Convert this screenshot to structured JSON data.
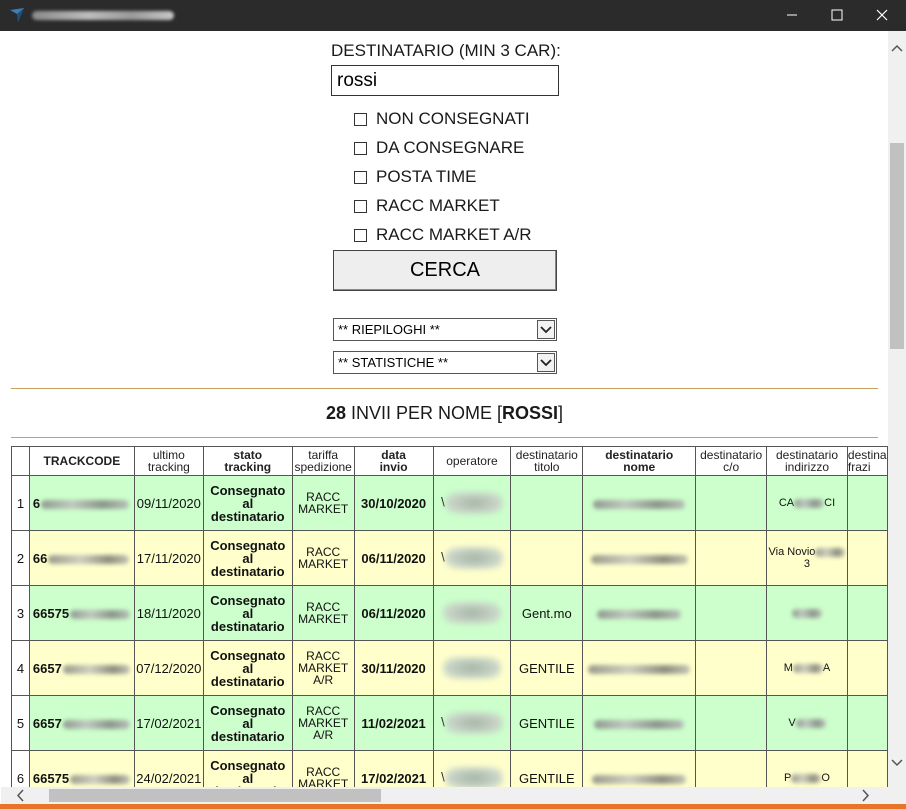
{
  "window": {
    "controls": {
      "minimize": "minimize-icon",
      "maximize": "maximize-icon",
      "close": "close-icon"
    }
  },
  "form": {
    "label": "DESTINATARIO (MIN 3 CAR):",
    "search_value": "rossi",
    "checkboxes": [
      {
        "label": "NON CONSEGNATI",
        "checked": false
      },
      {
        "label": "DA CONSEGNARE",
        "checked": false
      },
      {
        "label": "POSTA TIME",
        "checked": false
      },
      {
        "label": "RACC MARKET",
        "checked": false
      },
      {
        "label": "RACC MARKET A/R",
        "checked": false
      }
    ],
    "submit_label": "CERCA",
    "select_riepiloghi": "** RIEPILOGHI **",
    "select_statistiche": "** STATISTICHE **"
  },
  "results": {
    "count": "28",
    "text": "INVII PER NOME",
    "name": "ROSSI"
  },
  "table": {
    "headers": [
      {
        "line1": "",
        "line2": ""
      },
      {
        "line1": "TRACKCODE",
        "line2": ""
      },
      {
        "line1": "ultimo",
        "line2": "tracking"
      },
      {
        "line1": "stato",
        "line2": "tracking"
      },
      {
        "line1": "tariffa",
        "line2": "spedizione"
      },
      {
        "line1": "data",
        "line2": "invio"
      },
      {
        "line1": "operatore",
        "line2": ""
      },
      {
        "line1": "destinatario",
        "line2": "titolo"
      },
      {
        "line1": "destinatario",
        "line2": "nome"
      },
      {
        "line1": "destinatario",
        "line2": "c/o"
      },
      {
        "line1": "destinatario",
        "line2": "indirizzo"
      },
      {
        "line1": "destina",
        "line2": "frazi"
      }
    ],
    "rows": [
      {
        "idx": "1",
        "track": "6",
        "ultimo": "09/11/2020",
        "stato": [
          "Consegnato",
          "al",
          "destinatario"
        ],
        "tariffa": [
          "RACC",
          "MARKET"
        ],
        "data": "30/10/2020",
        "operatore": "\\",
        "titolo": "",
        "nome": "",
        "co": "",
        "indirizzo": [
          "CA",
          "CI"
        ],
        "frazione": ""
      },
      {
        "idx": "2",
        "track": "66",
        "ultimo": "17/11/2020",
        "stato": [
          "Consegnato",
          "al",
          "destinatario"
        ],
        "tariffa": [
          "RACC",
          "MARKET"
        ],
        "data": "06/11/2020",
        "operatore": "\\",
        "titolo": "",
        "nome": "",
        "co": "",
        "indirizzo": [
          "Via Novio",
          "3"
        ],
        "frazione": ""
      },
      {
        "idx": "3",
        "track": "66575",
        "ultimo": "18/11/2020",
        "stato": [
          "Consegnato",
          "al",
          "destinatario"
        ],
        "tariffa": [
          "RACC",
          "MARKET"
        ],
        "data": "06/11/2020",
        "operatore": "",
        "titolo": "Gent.mo",
        "nome": "",
        "co": "",
        "indirizzo": [
          "",
          ""
        ],
        "frazione": ""
      },
      {
        "idx": "4",
        "track": "6657",
        "ultimo": "07/12/2020",
        "stato": [
          "Consegnato",
          "al",
          "destinatario"
        ],
        "tariffa": [
          "RACC",
          "MARKET",
          "A/R"
        ],
        "data": "30/11/2020",
        "operatore": "",
        "titolo": "GENTILE",
        "nome": "",
        "co": "",
        "indirizzo": [
          "M",
          "A"
        ],
        "frazione": ""
      },
      {
        "idx": "5",
        "track": "6657",
        "ultimo": "17/02/2021",
        "stato": [
          "Consegnato",
          "al",
          "destinatario"
        ],
        "tariffa": [
          "RACC",
          "MARKET",
          "A/R"
        ],
        "data": "11/02/2021",
        "operatore": "\\",
        "titolo": "GENTILE",
        "nome": "",
        "co": "",
        "indirizzo": [
          "V",
          ""
        ],
        "frazione": ""
      },
      {
        "idx": "6",
        "track": "66575",
        "ultimo": "24/02/2021",
        "stato": [
          "Consegnato",
          "al",
          "destinatario"
        ],
        "tariffa": [
          "RACC",
          "MARKET"
        ],
        "data": "17/02/2021",
        "operatore": "\\",
        "titolo": "GENTILE",
        "nome": "",
        "co": "",
        "indirizzo": [
          "P",
          "O"
        ],
        "frazione": ""
      }
    ]
  },
  "scrollbars": {
    "vertical_position": 0.17,
    "horizontal_position": 0.04
  }
}
